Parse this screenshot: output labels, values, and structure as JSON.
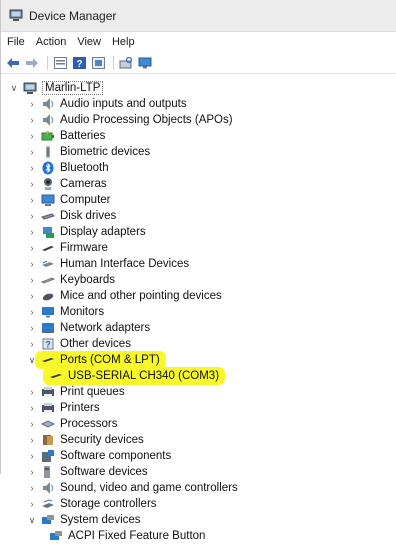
{
  "window": {
    "title": "Device Manager"
  },
  "menu": [
    "File",
    "Action",
    "View",
    "Help"
  ],
  "toolbar": {
    "buttons": [
      "back-arrow-icon",
      "forward-arrow-icon",
      "properties-icon",
      "help-icon",
      "update-driver-icon",
      "scan-hardware-icon",
      "monitor-icon"
    ]
  },
  "tree": {
    "root": "Marlin-LTP",
    "categories": [
      {
        "label": "Audio inputs and outputs",
        "icon": "audio-icon",
        "expanded": false
      },
      {
        "label": "Audio Processing Objects (APOs)",
        "icon": "audio-icon",
        "expanded": false
      },
      {
        "label": "Batteries",
        "icon": "battery-icon",
        "expanded": false
      },
      {
        "label": "Biometric devices",
        "icon": "biometric-icon",
        "expanded": false
      },
      {
        "label": "Bluetooth",
        "icon": "bluetooth-icon",
        "expanded": false
      },
      {
        "label": "Cameras",
        "icon": "camera-icon",
        "expanded": false
      },
      {
        "label": "Computer",
        "icon": "computer-icon",
        "expanded": false
      },
      {
        "label": "Disk drives",
        "icon": "disk-icon",
        "expanded": false
      },
      {
        "label": "Display adapters",
        "icon": "display-adapter-icon",
        "expanded": false
      },
      {
        "label": "Firmware",
        "icon": "firmware-icon",
        "expanded": false
      },
      {
        "label": "Human Interface Devices",
        "icon": "hid-icon",
        "expanded": false
      },
      {
        "label": "Keyboards",
        "icon": "keyboard-icon",
        "expanded": false
      },
      {
        "label": "Mice and other pointing devices",
        "icon": "mouse-icon",
        "expanded": false
      },
      {
        "label": "Monitors",
        "icon": "monitor-icon",
        "expanded": false
      },
      {
        "label": "Network adapters",
        "icon": "network-icon",
        "expanded": false
      },
      {
        "label": "Other devices",
        "icon": "other-devices-icon",
        "expanded": false
      },
      {
        "label": "Ports (COM & LPT)",
        "icon": "port-icon",
        "expanded": true,
        "highlighted": true,
        "children": [
          {
            "label": "USB-SERIAL CH340 (COM3)",
            "icon": "port-icon",
            "highlighted": true
          }
        ]
      },
      {
        "label": "Print queues",
        "icon": "printer-icon",
        "expanded": false
      },
      {
        "label": "Printers",
        "icon": "printer-icon",
        "expanded": false
      },
      {
        "label": "Processors",
        "icon": "processor-icon",
        "expanded": false
      },
      {
        "label": "Security devices",
        "icon": "security-icon",
        "expanded": false
      },
      {
        "label": "Software components",
        "icon": "software-component-icon",
        "expanded": false
      },
      {
        "label": "Software devices",
        "icon": "software-device-icon",
        "expanded": false
      },
      {
        "label": "Sound, video and game controllers",
        "icon": "audio-icon",
        "expanded": false
      },
      {
        "label": "Storage controllers",
        "icon": "storage-icon",
        "expanded": false
      },
      {
        "label": "System devices",
        "icon": "system-devices-icon",
        "expanded": true,
        "children": [
          {
            "label": "ACPI Fixed Feature Button",
            "icon": "system-devices-icon"
          }
        ]
      }
    ]
  },
  "colors": {
    "highlight": "#f7f72a",
    "bluetooth": "#1e6fd9",
    "folder": "#2b79c9"
  }
}
